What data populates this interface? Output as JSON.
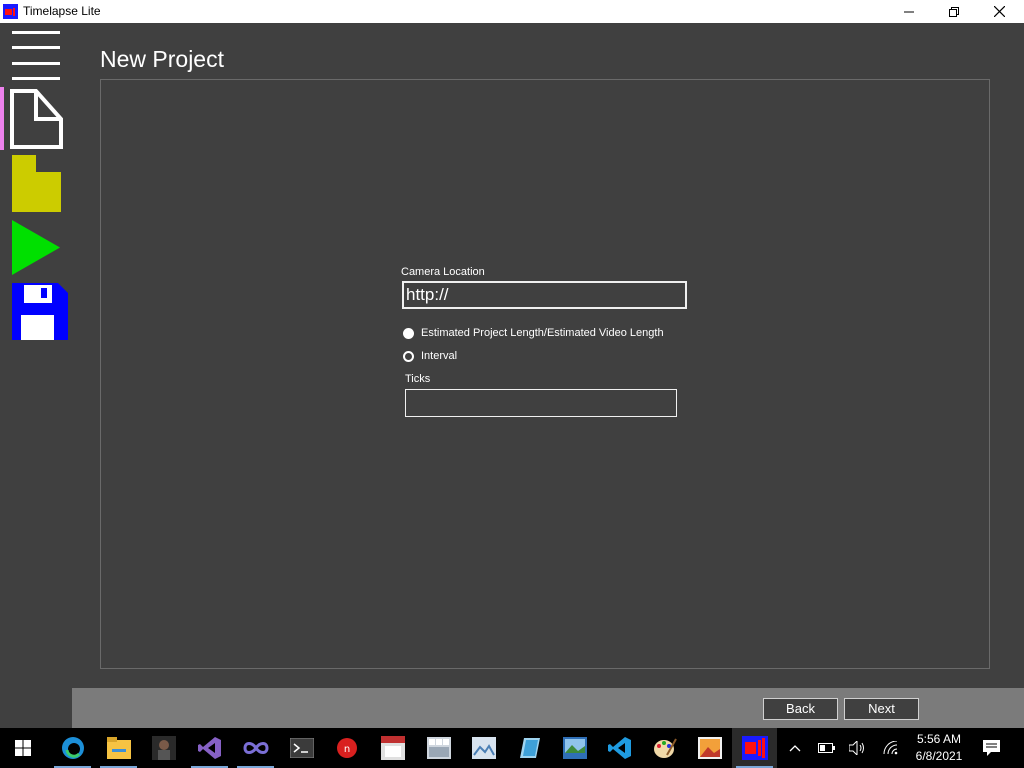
{
  "window": {
    "title": "Timelapse Lite",
    "minimize_icon": "minimize-icon",
    "restore_icon": "restore-icon",
    "close_icon": "close-icon"
  },
  "sidebar": {
    "items": [
      {
        "name": "menu",
        "icon": "hamburger-menu-icon"
      },
      {
        "name": "new-project",
        "icon": "new-document-icon",
        "selected": true
      },
      {
        "name": "open-project",
        "icon": "folder-icon",
        "color": "#cccc00"
      },
      {
        "name": "run",
        "icon": "play-icon",
        "color": "#00e000"
      },
      {
        "name": "save",
        "icon": "floppy-disk-icon",
        "color": "#0000ff"
      }
    ],
    "selected_indicator_color": "#ee82ee"
  },
  "page": {
    "title": "New Project"
  },
  "form": {
    "camera_location_label": "Camera Location",
    "camera_location_value": "http://",
    "radio_estimated_label": "Estimated Project Length/Estimated Video Length",
    "radio_interval_label": "Interval",
    "selected_mode": "Estimated Project Length/Estimated Video Length",
    "ticks_label": "Ticks",
    "ticks_value": ""
  },
  "footer": {
    "back_label": "Back",
    "next_label": "Next"
  },
  "taskbar": {
    "start_icon": "windows-start-icon",
    "apps": [
      {
        "icon": "edge-icon",
        "running": true
      },
      {
        "icon": "file-explorer-icon",
        "running": true
      },
      {
        "icon": "photo-app-icon",
        "running": false
      },
      {
        "icon": "visual-studio-icon",
        "running": true
      },
      {
        "icon": "infinity-app-icon",
        "running": true
      },
      {
        "icon": "terminal-icon",
        "running": false
      },
      {
        "icon": "red-app-icon",
        "running": false
      },
      {
        "icon": "calendar-app-icon",
        "running": false
      },
      {
        "icon": "grid-app-icon",
        "running": false
      },
      {
        "icon": "image-viewer-icon",
        "running": false
      },
      {
        "icon": "blue-app-icon",
        "running": false
      },
      {
        "icon": "photos-icon",
        "running": false
      },
      {
        "icon": "vscode-icon",
        "running": false
      },
      {
        "icon": "paint-icon",
        "running": false
      },
      {
        "icon": "image-editor-icon",
        "running": false
      },
      {
        "icon": "timelapse-app-icon",
        "running": true,
        "active": true
      }
    ],
    "tray": {
      "chevron_icon": "chevron-up-icon",
      "battery_icon": "battery-icon",
      "volume_icon": "volume-icon",
      "network_icon": "wifi-icon",
      "notification_icon": "notification-icon"
    },
    "time": "5:56 AM",
    "date": "6/8/2021"
  }
}
